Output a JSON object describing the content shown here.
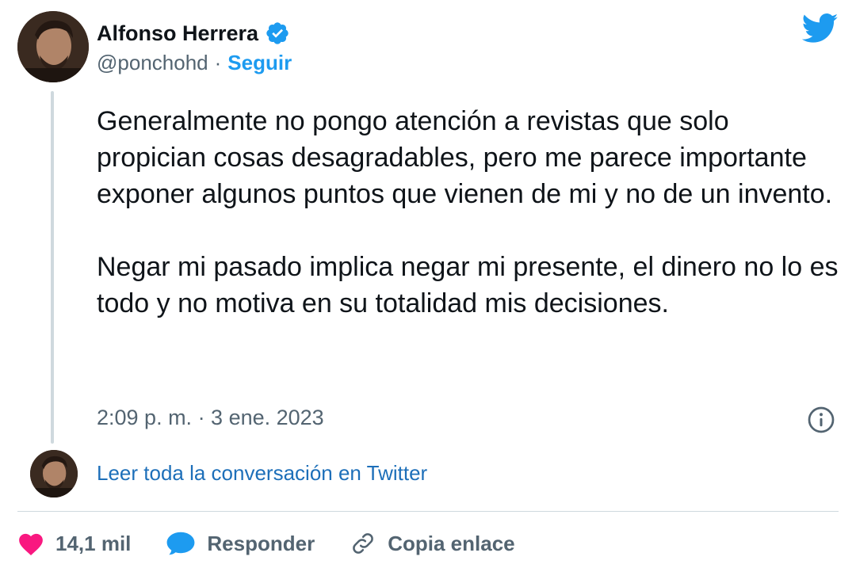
{
  "author": {
    "name": "Alfonso Herrera",
    "handle": "@ponchohd",
    "separator": "·",
    "follow_label": "Seguir",
    "verified_icon": "verified-badge-icon",
    "avatar": "avatar"
  },
  "brand": {
    "logo_icon": "twitter-bird-icon",
    "color": "#1d9bf0"
  },
  "tweet": {
    "text": "Generalmente no pongo atención a revistas que solo propician cosas desagradables, pero me parece importante exponer algunos puntos que vienen de mi y no de un invento.\n\nNegar mi pasado implica negar mi presente, el dinero no lo es todo y no motiva en su totalidad mis decisiones.",
    "timestamp": "2:09 p. m. · 3 ene. 2023",
    "info_icon": "info-icon"
  },
  "conversation": {
    "read_more_label": "Leer toda la conversación en Twitter"
  },
  "actions": {
    "like": {
      "icon": "heart-icon",
      "count": "14,1 mil",
      "color": "#f91880"
    },
    "reply": {
      "icon": "speech-bubble-icon",
      "label": "Responder",
      "color": "#1d9bf0"
    },
    "copy": {
      "icon": "link-icon",
      "label": "Copia enlace"
    }
  }
}
